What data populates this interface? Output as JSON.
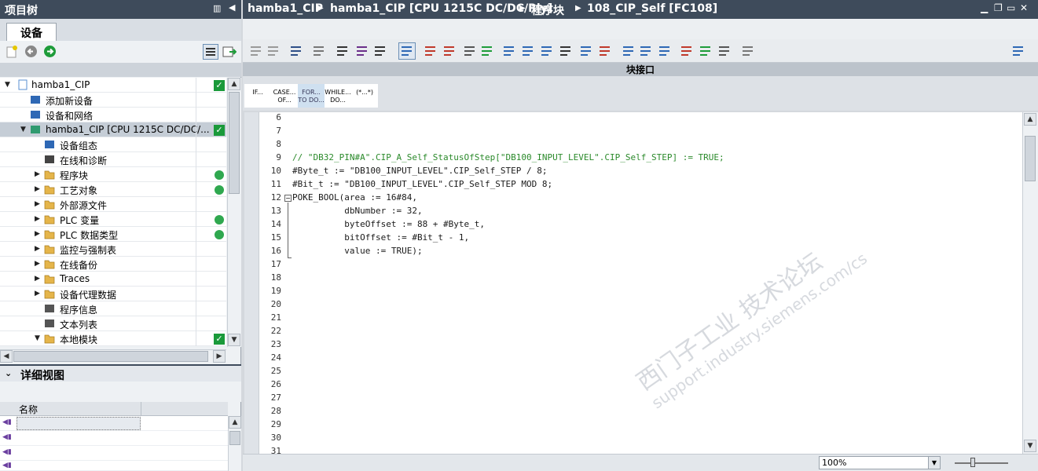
{
  "left_pane": {
    "title": "项目树",
    "tab": "设备",
    "tree": [
      {
        "label": "hamba1_CIP",
        "status": "check",
        "icon": "project-icon"
      },
      {
        "label": "添加新设备",
        "status": "",
        "icon": "add-device-icon"
      },
      {
        "label": "设备和网络",
        "status": "",
        "icon": "network-icon"
      },
      {
        "label": "hamba1_CIP [CPU 1215C DC/DC/...",
        "status": "check",
        "icon": "plc-icon"
      },
      {
        "label": "设备组态",
        "status": "",
        "icon": "config-icon"
      },
      {
        "label": "在线和诊断",
        "status": "",
        "icon": "diagnostics-icon"
      },
      {
        "label": "程序块",
        "status": "dot",
        "icon": "folder-icon"
      },
      {
        "label": "工艺对象",
        "status": "dot",
        "icon": "folder-icon"
      },
      {
        "label": "外部源文件",
        "status": "",
        "icon": "folder-icon"
      },
      {
        "label": "PLC 变量",
        "status": "dot",
        "icon": "folder-icon"
      },
      {
        "label": "PLC 数据类型",
        "status": "dot",
        "icon": "folder-icon"
      },
      {
        "label": "监控与强制表",
        "status": "",
        "icon": "folder-icon"
      },
      {
        "label": "在线备份",
        "status": "",
        "icon": "folder-icon"
      },
      {
        "label": "Traces",
        "status": "",
        "icon": "folder-icon"
      },
      {
        "label": "设备代理数据",
        "status": "",
        "icon": "folder-icon"
      },
      {
        "label": "程序信息",
        "status": "",
        "icon": "program-info-icon"
      },
      {
        "label": "文本列表",
        "status": "",
        "icon": "text-list-icon"
      },
      {
        "label": "本地模块",
        "status": "check",
        "icon": "folder-icon"
      }
    ],
    "detail_title": "详细视图",
    "detail_col": "名称"
  },
  "breadcrumb": {
    "parts": [
      "hamba1_CIP",
      "hamba1_CIP [CPU 1215C DC/DC/Rly]",
      "程序块",
      "108_CIP_Self [FC108]"
    ]
  },
  "editor": {
    "interface_label": "块接口",
    "snippets": [
      "IF...",
      "CASE... OF...",
      "FOR... TO DO...",
      "WHILE... DO...",
      "(*...*)"
    ],
    "lines": [
      {
        "no": "6",
        "text": "",
        "type": "code"
      },
      {
        "no": "7",
        "text": "",
        "type": "code"
      },
      {
        "no": "8",
        "text": "",
        "type": "code"
      },
      {
        "no": "9",
        "text": "// \"DB32_PIN#A\".CIP_A_Self_StatusOfStep[\"DB100_INPUT_LEVEL\".CIP_Self_STEP] := TRUE;",
        "type": "comment"
      },
      {
        "no": "10",
        "text": "#Byte_t := \"DB100_INPUT_LEVEL\".CIP_Self_STEP / 8;",
        "type": "code"
      },
      {
        "no": "11",
        "text": "#Bit_t := \"DB100_INPUT_LEVEL\".CIP_Self_STEP MOD 8;",
        "type": "code"
      },
      {
        "no": "12",
        "text": "POKE_BOOL(area := 16#84,",
        "type": "code"
      },
      {
        "no": "13",
        "text": "          dbNumber := 32,",
        "type": "code"
      },
      {
        "no": "14",
        "text": "          byteOffset := 88 + #Byte_t,",
        "type": "code"
      },
      {
        "no": "15",
        "text": "          bitOffset := #Bit_t - 1,",
        "type": "code"
      },
      {
        "no": "16",
        "text": "          value := TRUE);",
        "type": "code"
      },
      {
        "no": "17",
        "text": "",
        "type": "code"
      },
      {
        "no": "18",
        "text": "",
        "type": "code"
      },
      {
        "no": "19",
        "text": "",
        "type": "code"
      },
      {
        "no": "20",
        "text": "",
        "type": "code"
      },
      {
        "no": "21",
        "text": "",
        "type": "code"
      },
      {
        "no": "22",
        "text": "",
        "type": "code"
      },
      {
        "no": "23",
        "text": "",
        "type": "code"
      },
      {
        "no": "24",
        "text": "",
        "type": "code"
      },
      {
        "no": "25",
        "text": "",
        "type": "code"
      },
      {
        "no": "26",
        "text": "",
        "type": "code"
      },
      {
        "no": "27",
        "text": "",
        "type": "code"
      },
      {
        "no": "28",
        "text": "",
        "type": "code"
      },
      {
        "no": "29",
        "text": "",
        "type": "code"
      },
      {
        "no": "30",
        "text": "",
        "type": "code"
      },
      {
        "no": "31",
        "text": "",
        "type": "code"
      }
    ],
    "watermark_cn": "西门子工业   技术论坛",
    "watermark_url": "support.industry.siemens.com/cs",
    "zoom": "100%"
  },
  "colors": {
    "titlebar": "#3e4b5b",
    "comment": "#2b8a2b",
    "status_green": "#1a9a3a"
  }
}
